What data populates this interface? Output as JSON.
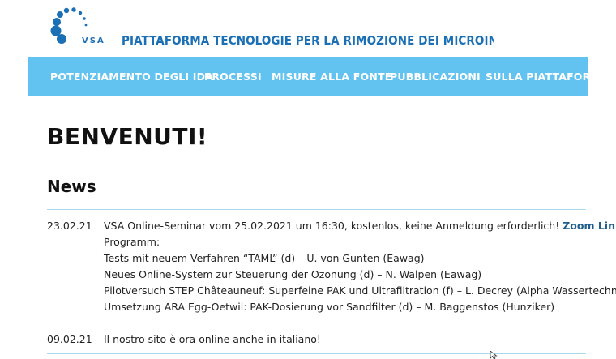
{
  "logo": {
    "text": "VSA"
  },
  "site_title": "PIATTAFORMA TECNOLOGIE PER LA RIMOZIONE DEI MICROINQUINANTI",
  "nav": {
    "items": [
      "POTENZIAMENTO DEGLI IDA",
      "PROCESSI",
      "MISURE ALLA FONTE",
      "PUBBLICAZIONI",
      "SULLA PIATTAFORMA"
    ]
  },
  "page_title": "BENVENUTI!",
  "news": {
    "heading": "News",
    "entries": [
      {
        "date": "23.02.21",
        "lead": "VSA Online-Seminar vom 25.02.2021 um 16:30, kostenlos, keine Anmeldung erforderlich!",
        "link": "Zoom Link",
        "lines": [
          "Programm:",
          "Tests mit neuem Verfahren “TAML” (d) – U. von Gunten (Eawag)",
          "Neues Online-System zur Steuerung der Ozonung (d) – N. Walpen (Eawag)",
          "Pilotversuch STEP Châteauneuf: Superfeine PAK und Ultrafiltration (f) – L. Decrey (Alpha Wassertechnik)",
          "Umsetzung ARA Egg-Oetwil: PAK-Dosierung vor Sandfilter (d) – M. Baggenstos (Hunziker)"
        ]
      },
      {
        "date": "09.02.21",
        "lead": "Il nostro sito è ora online anche in italiano!"
      }
    ]
  },
  "colors": {
    "nav_bg": "#63c3f0",
    "brand_blue": "#1a6fb5",
    "link": "#1f5e8c",
    "divider": "#a9d8ef"
  }
}
